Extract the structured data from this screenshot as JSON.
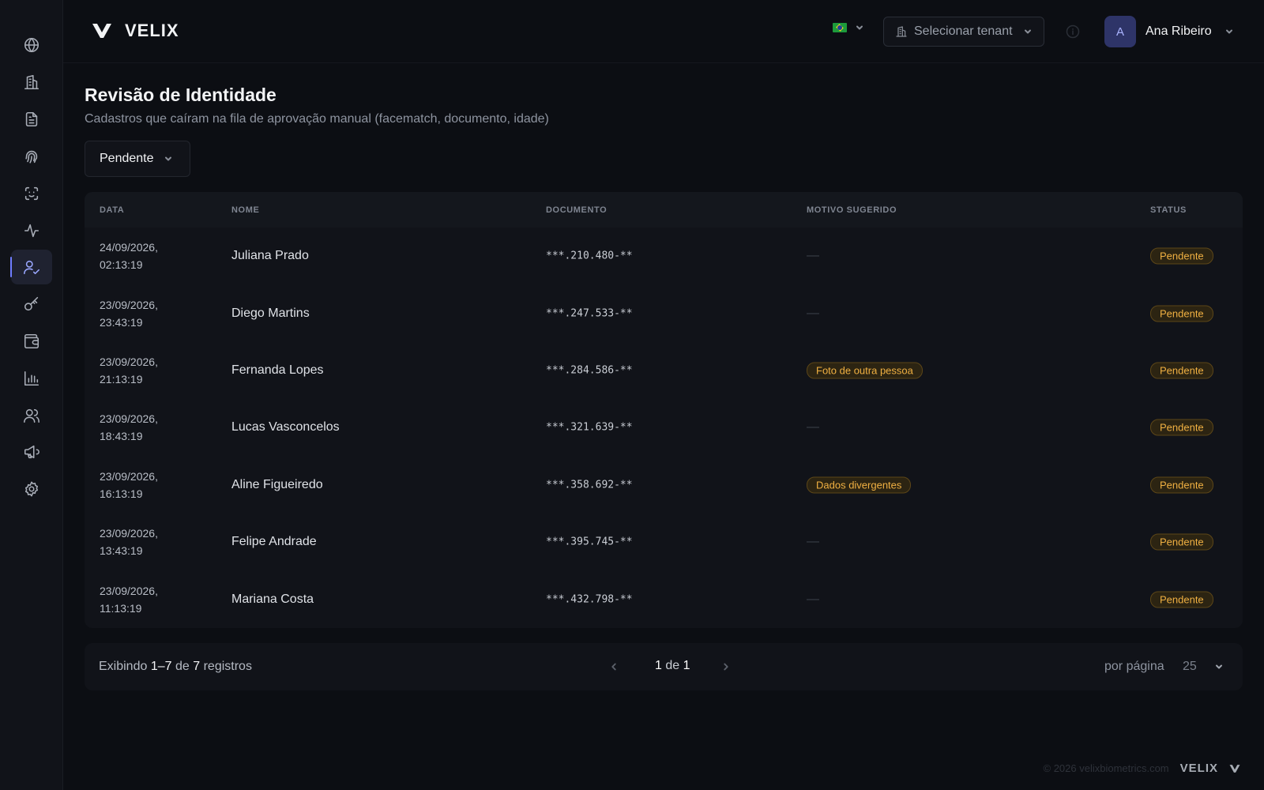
{
  "app": {
    "brand": "VELIX"
  },
  "header": {
    "language": "pt-BR",
    "tenant_placeholder": "Selecionar tenant",
    "user": {
      "initial": "A",
      "name": "Ana Ribeiro"
    }
  },
  "sidebar": {
    "items": [
      {
        "name": "globe-icon",
        "active": false
      },
      {
        "name": "building-icon",
        "active": false
      },
      {
        "name": "document-icon",
        "active": false
      },
      {
        "name": "fingerprint-icon",
        "active": false
      },
      {
        "name": "face-scan-icon",
        "active": false
      },
      {
        "name": "activity-icon",
        "active": false
      },
      {
        "name": "user-check-icon",
        "active": true
      },
      {
        "name": "key-icon",
        "active": false
      },
      {
        "name": "wallet-icon",
        "active": false
      },
      {
        "name": "bar-chart-icon",
        "active": false
      },
      {
        "name": "users-icon",
        "active": false
      },
      {
        "name": "megaphone-icon",
        "active": false
      },
      {
        "name": "settings-icon",
        "active": false
      }
    ]
  },
  "page": {
    "title": "Revisão de Identidade",
    "subtitle": "Cadastros que caíram na fila de aprovação manual (facematch, documento, idade)",
    "filter_value": "Pendente"
  },
  "table": {
    "columns": [
      "DATA",
      "NOME",
      "DOCUMENTO",
      "MOTIVO SUGERIDO",
      "STATUS"
    ],
    "rows": [
      {
        "date": "24/09/2026,",
        "time": "02:13:19",
        "name": "Juliana Prado",
        "doc": "***.210.480-**",
        "reason": "—",
        "reason_badge": false,
        "status": "Pendente"
      },
      {
        "date": "23/09/2026,",
        "time": "23:43:19",
        "name": "Diego Martins",
        "doc": "***.247.533-**",
        "reason": "—",
        "reason_badge": false,
        "status": "Pendente"
      },
      {
        "date": "23/09/2026,",
        "time": "21:13:19",
        "name": "Fernanda Lopes",
        "doc": "***.284.586-**",
        "reason": "Foto de outra pessoa",
        "reason_badge": true,
        "status": "Pendente"
      },
      {
        "date": "23/09/2026,",
        "time": "18:43:19",
        "name": "Lucas Vasconcelos",
        "doc": "***.321.639-**",
        "reason": "—",
        "reason_badge": false,
        "status": "Pendente"
      },
      {
        "date": "23/09/2026,",
        "time": "16:13:19",
        "name": "Aline Figueiredo",
        "doc": "***.358.692-**",
        "reason": "Dados divergentes",
        "reason_badge": true,
        "status": "Pendente"
      },
      {
        "date": "23/09/2026,",
        "time": "13:43:19",
        "name": "Felipe Andrade",
        "doc": "***.395.745-**",
        "reason": "—",
        "reason_badge": false,
        "status": "Pendente"
      },
      {
        "date": "23/09/2026,",
        "time": "11:13:19",
        "name": "Mariana Costa",
        "doc": "***.432.798-**",
        "reason": "—",
        "reason_badge": false,
        "status": "Pendente"
      }
    ]
  },
  "pagination": {
    "prefix": "Exibindo",
    "range": "1–7",
    "of_word": "de",
    "total": "7",
    "suffix": "registros",
    "current_page": "1",
    "page_of": "de",
    "total_pages": "1",
    "per_page_label": "por página",
    "per_page_value": "25"
  },
  "footer": {
    "copyright": "© 2026 velixbiometrics.com",
    "brand": "VELIX"
  },
  "colors": {
    "accent": "#6f7dff",
    "badge_text": "#f0b042",
    "badge_bg": "#2c2412"
  }
}
